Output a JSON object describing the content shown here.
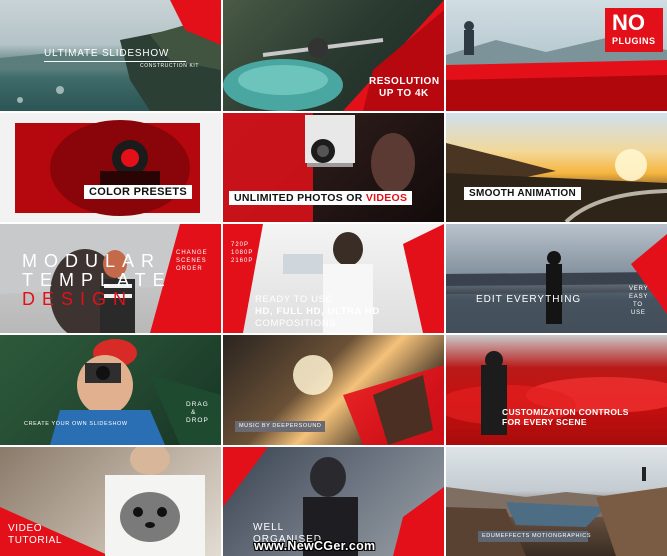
{
  "tiles": {
    "t1": {
      "title": "ULTIMATE SLIDESHOW",
      "subtitle": "CONSTRUCTION KIT"
    },
    "t2": {
      "line1": "RESOLUTION",
      "line2": "UP TO 4K"
    },
    "t3": {
      "line1": "NO",
      "line2": "PLUGINS"
    },
    "t4": {
      "label": "COLOR PRESETS"
    },
    "t5": {
      "label_a": "UNLIMITED PHOTOS OR ",
      "label_b": "VIDEOS"
    },
    "t6": {
      "label": "SMOOTH ANIMATION"
    },
    "t7": {
      "line1": "MODULAR",
      "line2": "TEMPLATE",
      "line3": "DESIGN",
      "side1": "CHANGE",
      "side2": "SCENES",
      "side3": "ORDER"
    },
    "t8": {
      "line1": "READY TO USE",
      "line2": "HD, FULL HD, ULTRA HD",
      "line3": "COMPOSITIONS",
      "res1": "720P",
      "res2": "1080P",
      "res3": "2160P"
    },
    "t9": {
      "label": "EDIT EVERYTHING",
      "side1": "VERY",
      "side2": "EASY",
      "side3": "TO",
      "side4": "USE"
    },
    "t10": {
      "label": "CREATE YOUR OWN SLIDESHOW",
      "side1": "DRAG",
      "side2": "&",
      "side3": "DROP"
    },
    "t11": {
      "label": "MUSIC BY DEEPERSOUND"
    },
    "t12": {
      "line1": "CUSTOMIZATION CONTROLS",
      "line2": "FOR EVERY SCENE"
    },
    "t13": {
      "line1": "VIDEO",
      "line2": "TUTORIAL"
    },
    "t14": {
      "line1": "WELL",
      "line2": "ORGANISED"
    },
    "t15": {
      "label": "EDUMEFFECTS MOTIONGRAPHICS"
    }
  },
  "watermark": "www.NewCGer.com",
  "colors": {
    "accent": "#e3101a",
    "white": "#ffffff"
  }
}
